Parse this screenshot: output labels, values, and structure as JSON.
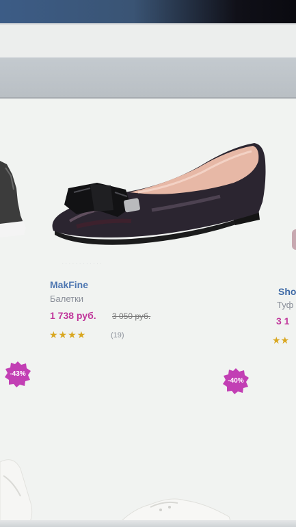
{
  "products": {
    "main": {
      "brand": "MakFine",
      "category": "Балетки",
      "price": "1 738 руб.",
      "old_price": "3 050 руб.",
      "rating_stars": "★★★★",
      "reviews": "(19)",
      "image_icon": "ballet-flat-shoe-image"
    },
    "right": {
      "brand": "Sho",
      "category": "Туф",
      "price": "3 1",
      "rating_stars": "★★"
    }
  },
  "badges": {
    "left": "-43%",
    "right": "-40%"
  },
  "colors": {
    "brand": "#4d76b1",
    "price": "#c0359a",
    "badge": "#c23fb4",
    "star": "#d9a720"
  }
}
